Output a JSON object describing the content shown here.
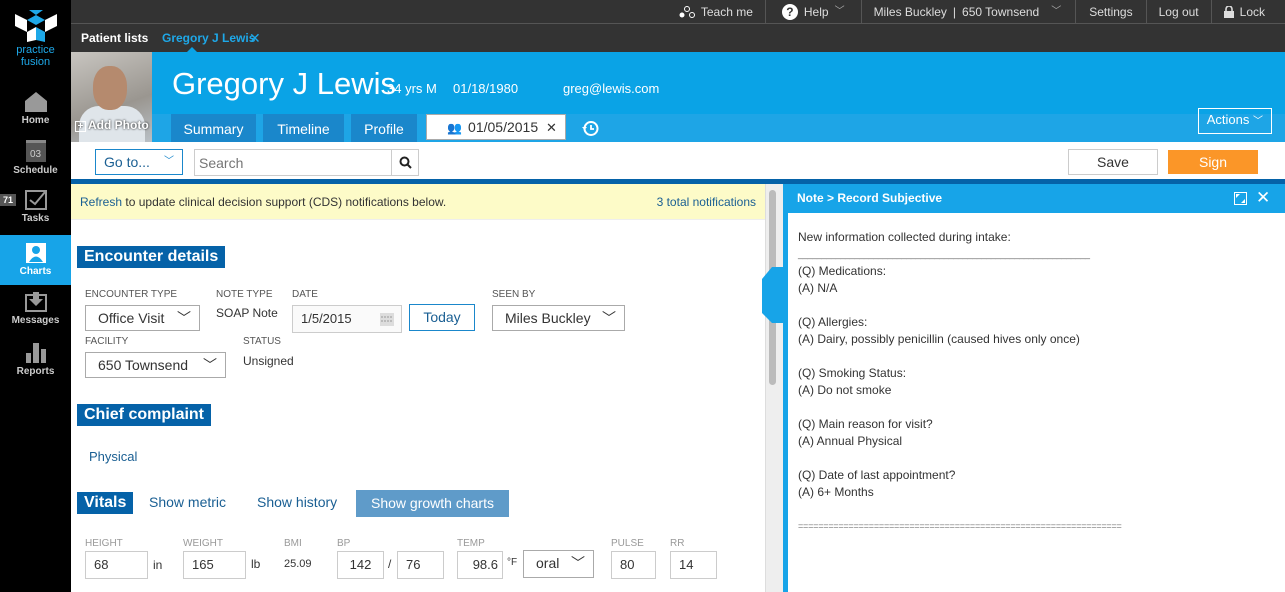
{
  "app": {
    "logo_line1": "practice",
    "logo_line2": "fusion"
  },
  "sidebar": {
    "items": [
      {
        "label": "Home",
        "icon": "home-icon"
      },
      {
        "label": "Schedule",
        "icon": "calendar-icon",
        "calendar_day": "03"
      },
      {
        "label": "Tasks",
        "icon": "checkbox-icon",
        "badge": "71"
      },
      {
        "label": "Charts",
        "icon": "person-icon",
        "active": true
      },
      {
        "label": "Messages",
        "icon": "inbox-icon"
      },
      {
        "label": "Reports",
        "icon": "bar-chart-icon"
      }
    ]
  },
  "topbar": {
    "teach_me": "Teach me",
    "help": "Help",
    "user": "Miles Buckley",
    "location": "650 Townsend",
    "settings": "Settings",
    "logout": "Log out",
    "lock": "Lock"
  },
  "tabs": {
    "patient_lists": "Patient lists",
    "patient_tab": "Gregory J Lewis"
  },
  "patient": {
    "name": "Gregory J Lewis",
    "age_sex": "34 yrs M",
    "dob": "01/18/1980",
    "email": "greg@lewis.com",
    "add_photo": "Add Photo"
  },
  "patient_tabs": [
    {
      "label": "Summary"
    },
    {
      "label": "Timeline"
    },
    {
      "label": "Profile"
    },
    {
      "label": "01/05/2015",
      "selected": true
    }
  ],
  "actions_label": "Actions",
  "toolbar": {
    "goto": "Go to...",
    "search_placeholder": "Search",
    "save": "Save",
    "sign": "Sign"
  },
  "cds": {
    "refresh": "Refresh",
    "message": "to update clinical decision support (CDS) notifications below.",
    "total": "3 total notifications"
  },
  "encounter": {
    "title": "Encounter details",
    "encounter_type_label": "ENCOUNTER TYPE",
    "encounter_type": "Office Visit",
    "note_type_label": "NOTE TYPE",
    "note_type": "SOAP Note",
    "date_label": "DATE",
    "date": "1/5/2015",
    "today": "Today",
    "seen_by_label": "SEEN BY",
    "seen_by": "Miles Buckley",
    "facility_label": "FACILITY",
    "facility": "650 Townsend",
    "status_label": "STATUS",
    "status": "Unsigned"
  },
  "chief_complaint": {
    "title": "Chief complaint",
    "value": "Physical"
  },
  "vitals": {
    "title": "Vitals",
    "show_metric": "Show metric",
    "show_history": "Show history",
    "show_growth": "Show growth charts",
    "height_label": "HEIGHT",
    "height": "68",
    "height_unit": "in",
    "weight_label": "WEIGHT",
    "weight": "165",
    "weight_unit": "lb",
    "bmi_label": "BMI",
    "bmi": "25.09",
    "bp_label": "BP",
    "bp_sys": "142",
    "bp_sep": "/",
    "bp_dia": "76",
    "temp_label": "TEMP",
    "temp": "98.6",
    "temp_unit": "°F",
    "temp_method": "oral",
    "pulse_label": "PULSE",
    "pulse": "80",
    "rr_label": "RR",
    "rr": "14"
  },
  "panel": {
    "title": "Note > Record Subjective",
    "lines": [
      "New information collected during intake:",
      "______________________________________________________________",
      "(Q) Medications:",
      "(A) N/A",
      "",
      "(Q) Allergies:",
      "(A) Dairy, possibly penicillin (caused hives only once)",
      "",
      "(Q) Smoking Status:",
      "(A) Do not smoke",
      "",
      "(Q) Main reason for visit?",
      "(A) Annual Physical",
      "",
      "(Q) Date of last appointment?",
      "(A) 6+ Months",
      "",
      "================================================================"
    ]
  }
}
